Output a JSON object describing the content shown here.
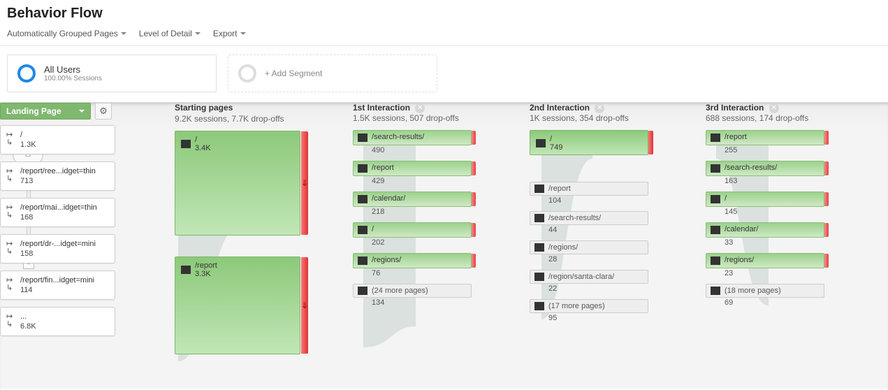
{
  "page": {
    "title": "Behavior Flow"
  },
  "toolbar": {
    "grouped": "Automatically Grouped Pages",
    "level": "Level of Detail",
    "export": "Export"
  },
  "segments": {
    "active": {
      "title": "All Users",
      "subtitle": "100.00% Sessions"
    },
    "add_label": "+ Add Segment"
  },
  "dimension": {
    "label": "Landing Page"
  },
  "columns": {
    "landing": {
      "items": [
        {
          "title": "/",
          "value": "1.3K"
        },
        {
          "title": "/report/ree...idget=thin",
          "value": "713"
        },
        {
          "title": "/report/mai...idget=thin",
          "value": "168"
        },
        {
          "title": "/report/dr-...idget=mini",
          "value": "158"
        },
        {
          "title": "/report/fin...idget=mini",
          "value": "114"
        },
        {
          "title": "...",
          "value": "6.8K"
        }
      ]
    },
    "starting": {
      "header": "Starting pages",
      "sub": "9.2K sessions, 7.7K drop-offs",
      "nodes": [
        {
          "title": "/",
          "value": "3.4K"
        },
        {
          "title": "/report",
          "value": "3.3K"
        }
      ]
    },
    "int1": {
      "header": "1st Interaction",
      "sub": "1.5K sessions, 507 drop-offs",
      "nodes": [
        {
          "title": "/search-results/",
          "value": "490"
        },
        {
          "title": "/report",
          "value": "429"
        },
        {
          "title": "/calendar/",
          "value": "218"
        },
        {
          "title": "/",
          "value": "202"
        },
        {
          "title": "/regions/",
          "value": "76"
        }
      ],
      "more": {
        "title": "(24 more pages)",
        "value": "134"
      }
    },
    "int2": {
      "header": "2nd Interaction",
      "sub": "1K sessions, 354 drop-offs",
      "nodes": [
        {
          "title": "/",
          "value": "749"
        }
      ],
      "flats": [
        {
          "title": "/report",
          "value": "104"
        },
        {
          "title": "/search-results/",
          "value": "44"
        },
        {
          "title": "/regions/",
          "value": "28"
        },
        {
          "title": "/region/santa-clara/",
          "value": "22"
        }
      ],
      "more": {
        "title": "(17 more pages)",
        "value": "95"
      }
    },
    "int3": {
      "header": "3rd Interaction",
      "sub": "688 sessions, 174 drop-offs",
      "nodes": [
        {
          "title": "/report",
          "value": "255"
        },
        {
          "title": "/search-results/",
          "value": "163"
        },
        {
          "title": "/",
          "value": "145"
        },
        {
          "title": "/calendar/",
          "value": "33"
        },
        {
          "title": "/regions/",
          "value": "23"
        }
      ],
      "more": {
        "title": "(18 more pages)",
        "value": "69"
      }
    }
  },
  "colors": {
    "node_green": "#8cc97a",
    "dropoff_red": "#d33"
  }
}
